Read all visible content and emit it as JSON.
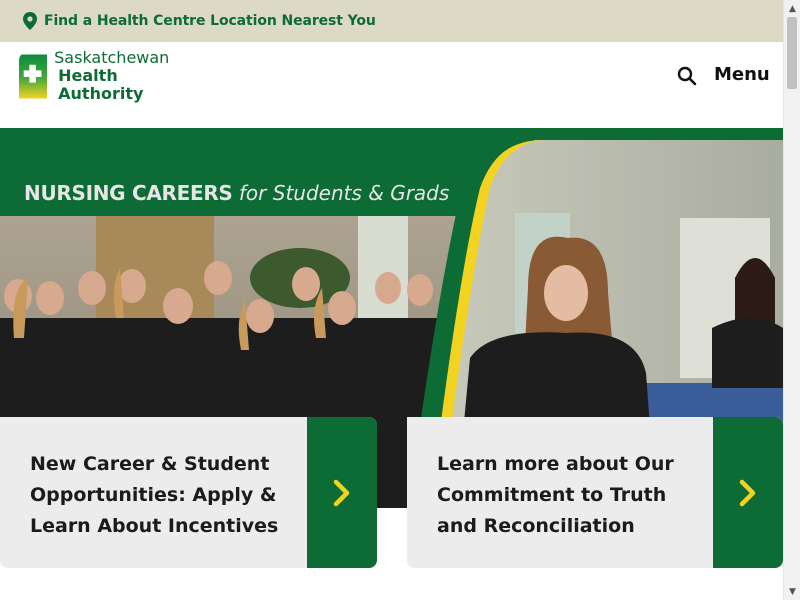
{
  "topbar": {
    "location_link": "Find a Health Centre Location Nearest You",
    "icon": "map-pin-icon"
  },
  "header": {
    "logo_line1": "Saskatchewan",
    "logo_line2": "Health Authority",
    "search_icon": "search-icon",
    "menu_label": "Menu"
  },
  "hero": {
    "title_bold": "NURSING CAREERS",
    "title_italic": "for Students & Grads"
  },
  "cards": [
    {
      "label": "New Career & Student Opportunities: Apply & Learn About Incentives",
      "icon": "chevron-right-icon"
    },
    {
      "label": "Learn more about Our Commitment to Truth and Reconciliation",
      "icon": "chevron-right-icon"
    }
  ],
  "colors": {
    "brand_green": "#0d6b35",
    "brand_yellow": "#f2d322",
    "topbar_bg": "#dcd9c5",
    "card_bg": "#ececec"
  }
}
